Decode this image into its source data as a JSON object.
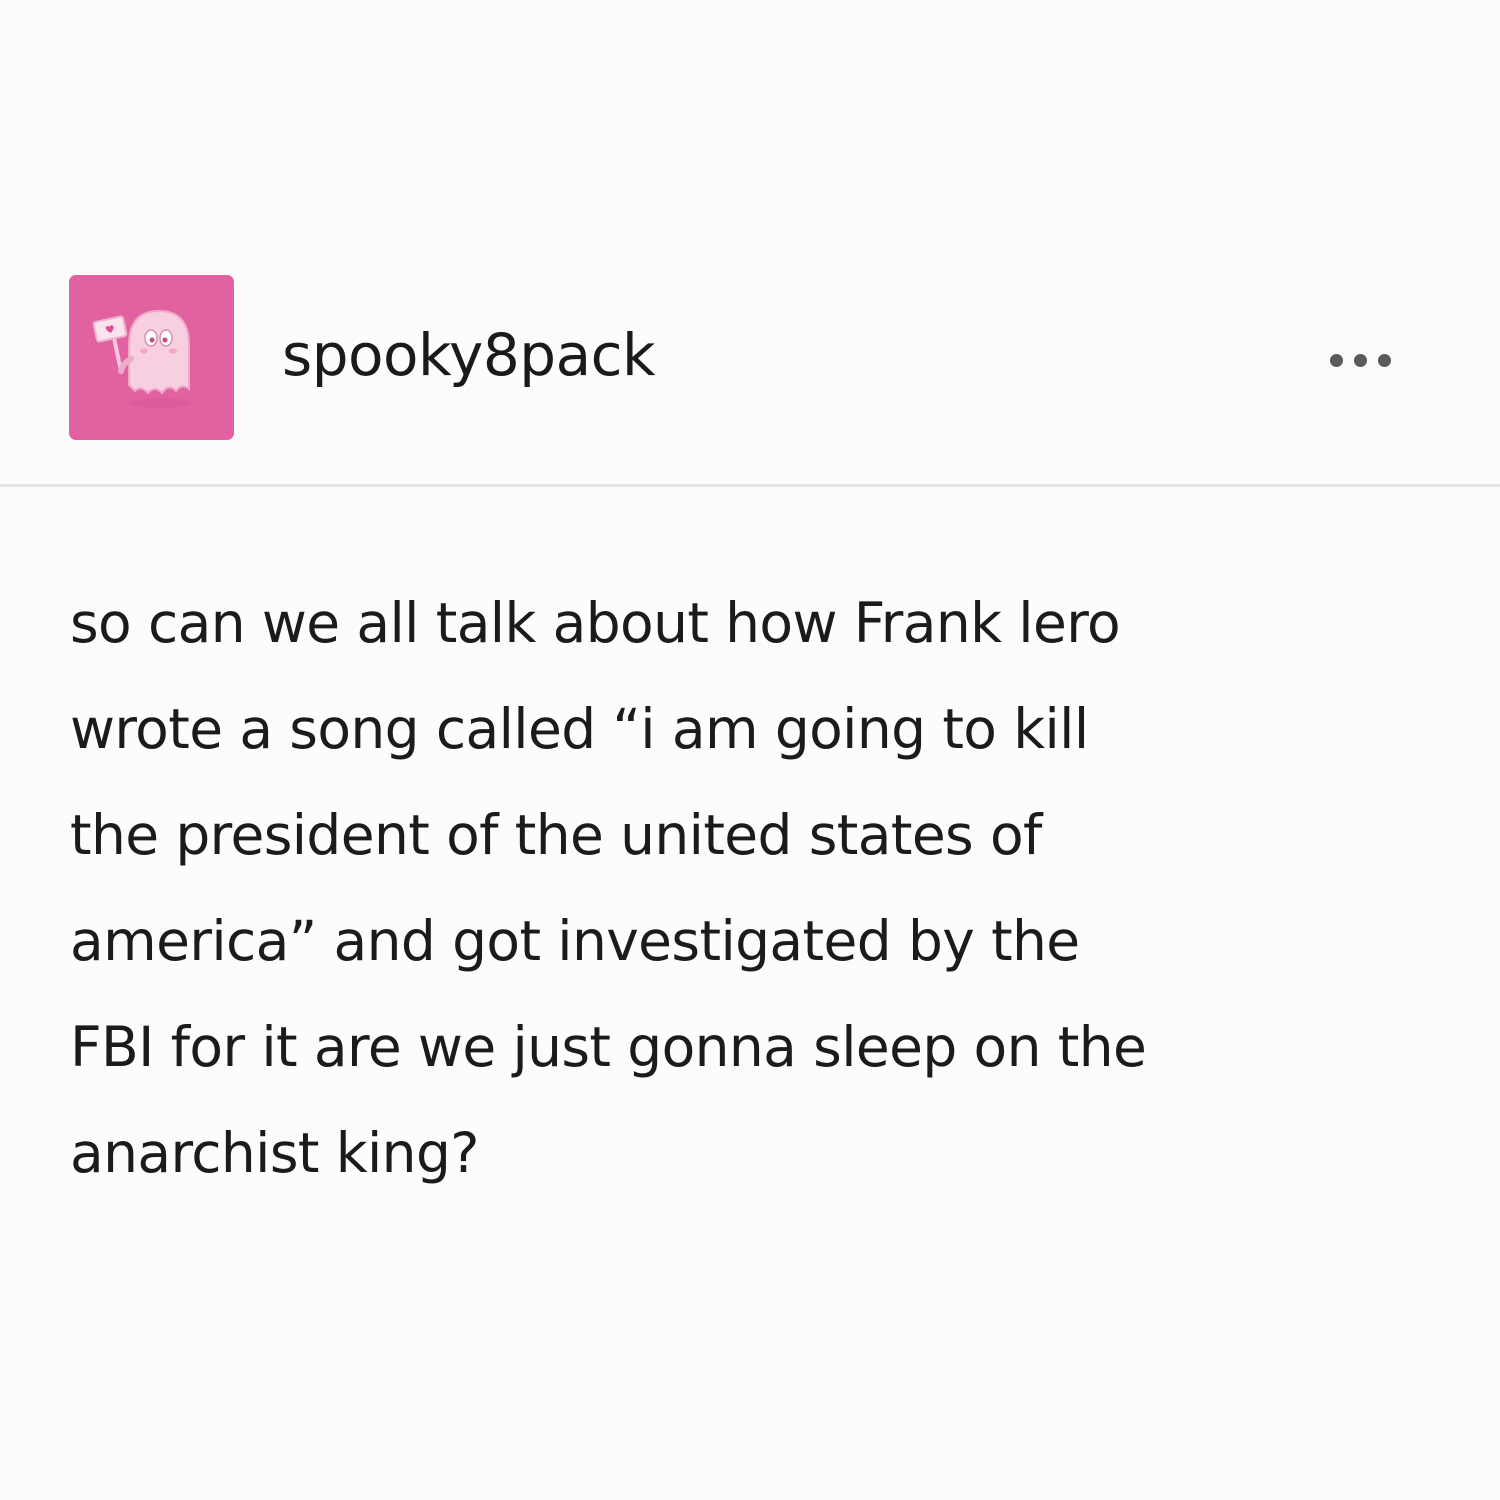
{
  "post": {
    "avatar_icon": "ghost-holding-heart-sign-icon",
    "username": "spooky8pack",
    "more_icon": "more-options-icon",
    "body_lines": [
      "so can we all talk about how Frank lero",
      "wrote a song called “i am going to kill",
      "the president of the united states of",
      "america” and got investigated by the",
      "FBI for it are we just gonna sleep on the",
      "anarchist king?"
    ]
  },
  "colors": {
    "avatar_background": "#e261a0",
    "divider": "#e4e2e2",
    "text": "#1b1b1b"
  }
}
